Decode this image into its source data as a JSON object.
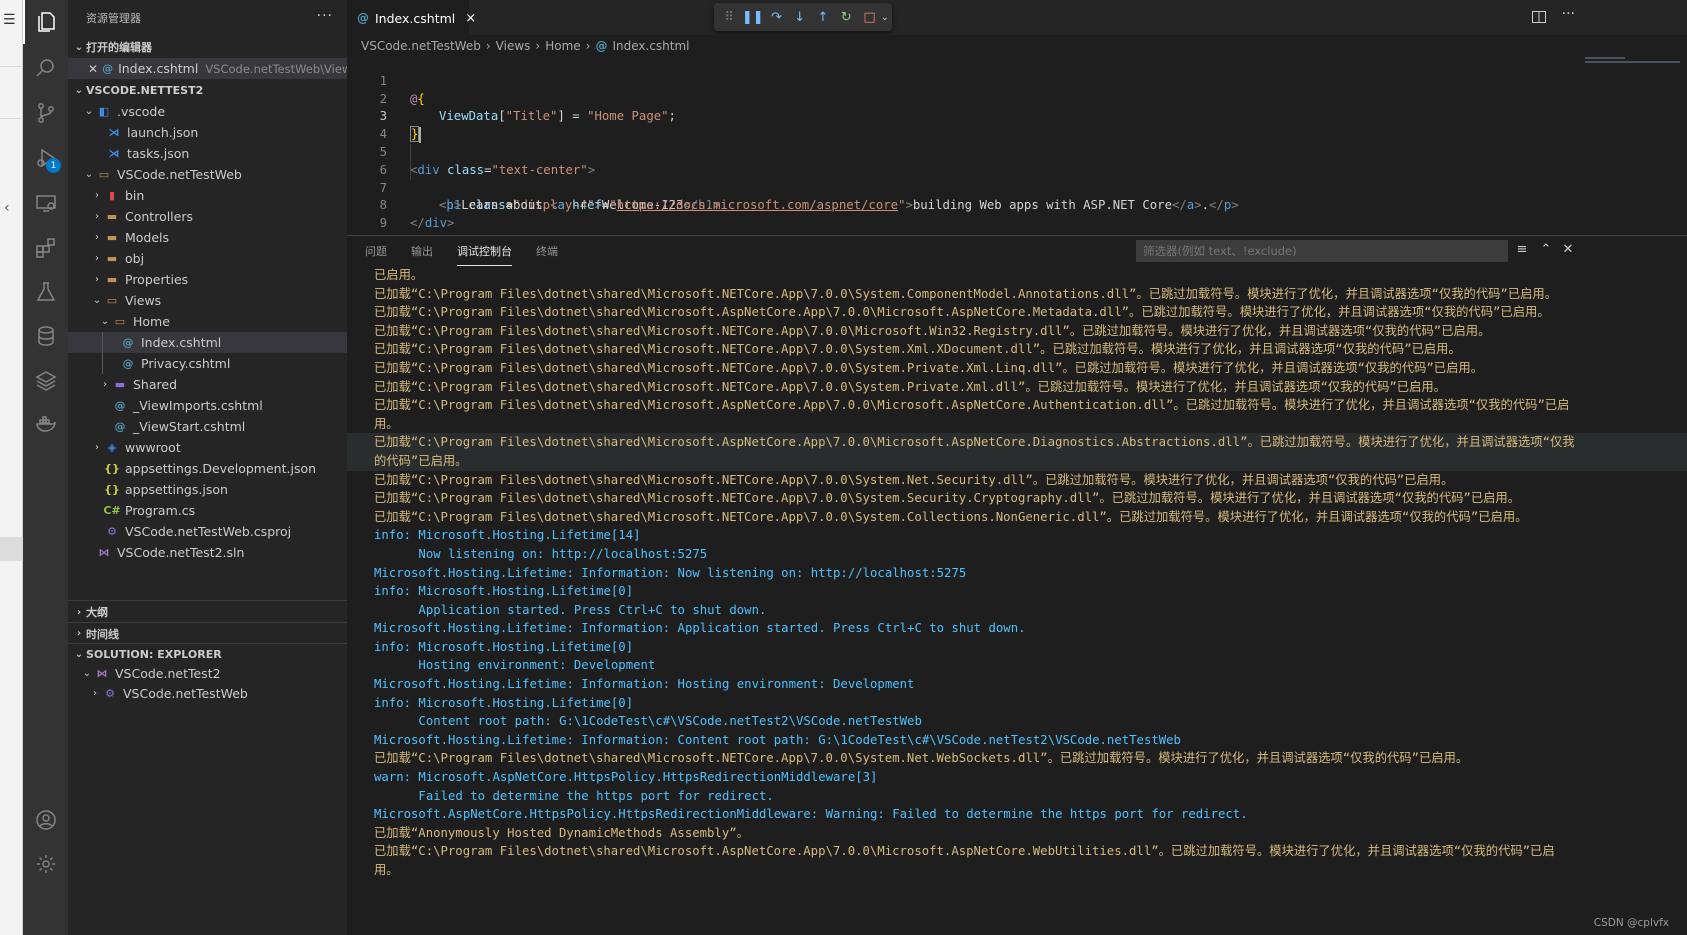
{
  "explorer": {
    "title": "资源管理器",
    "more": "···",
    "open_editors_label": "打开的编辑器",
    "open_editor": {
      "name": "Index.cshtml",
      "path": "VSCode.netTestWeb\\Views\\..."
    },
    "workspace_label": "VSCODE.NETTEST2",
    "tree": {
      "vscode_folder": ".vscode",
      "launch": "launch.json",
      "tasks": "tasks.json",
      "project": "VSCode.netTestWeb",
      "bin": "bin",
      "controllers": "Controllers",
      "models": "Models",
      "obj": "obj",
      "properties": "Properties",
      "views": "Views",
      "home": "Home",
      "index": "Index.cshtml",
      "privacy": "Privacy.cshtml",
      "shared": "Shared",
      "viewimports": "_ViewImports.cshtml",
      "viewstart": "_ViewStart.cshtml",
      "wwwroot": "wwwroot",
      "appsettings_dev": "appsettings.Development.json",
      "appsettings": "appsettings.json",
      "program": "Program.cs",
      "csproj": "VSCode.netTestWeb.csproj",
      "sln": "VSCode.netTest2.sln"
    },
    "outline_label": "大纲",
    "timeline_label": "时间线",
    "solution_label": "SOLUTION: EXPLORER",
    "solution_tree": {
      "solution": "VSCode.netTest2",
      "project": "VSCode.netTestWeb"
    }
  },
  "activity": {
    "debug_badge": "1"
  },
  "editor": {
    "tab_label": "Index.cshtml",
    "tab_close": "×",
    "breadcrumb": [
      "VSCode.netTestWeb",
      "Views",
      "Home",
      "Index.cshtml"
    ],
    "line_numbers": [
      "1",
      "2",
      "3",
      "4",
      "5",
      "6",
      "7",
      "8",
      "9"
    ],
    "code": {
      "l1_at": "@",
      "l1_brace": "{",
      "l2_viewdata": "ViewData",
      "l2_open": "[",
      "l2_key": "\"Title\"",
      "l2_close": "] = ",
      "l2_val": "\"Home Page\"",
      "l2_semi": ";",
      "l3_brace": "}",
      "l5_lt": "<",
      "l5_div": "div",
      "l5_class": "class",
      "l5_eq": "=",
      "l5_val": "\"text-center\"",
      "l5_gt": ">",
      "l6_lt": "<",
      "l6_h1": "h1",
      "l6_class": "class",
      "l6_eq": "=",
      "l6_val": "\"display-4\"",
      "l6_gt": ">",
      "l6_text": "Welcome-123",
      "l6_close": "</h1>",
      "l6_close_tag": "h1",
      "l7_lt": "<",
      "l7_p": "p",
      "l7_gt": ">",
      "l7_text1": "Learn about ",
      "l7_a_lt": "<",
      "l7_a": "a",
      "l7_href": "href",
      "l7_eq": "=",
      "l7_q1": "\"",
      "l7_url": "https://docs.microsoft.com/aspnet/core",
      "l7_q2": "\"",
      "l7_a_gt": ">",
      "l7_text2": "building Web apps with ASP.NET Core",
      "l7_a_close_lt": "</",
      "l7_a_close": "a",
      "l7_a_close_gt": ">",
      "l7_dot": ".",
      "l7_p_close_lt": "</",
      "l7_p_close": "p",
      "l7_p_close_gt": ">",
      "l8_lt": "</",
      "l8_div": "div",
      "l8_gt": ">"
    }
  },
  "panel": {
    "tabs": [
      "问题",
      "输出",
      "调试控制台",
      "终端"
    ],
    "filter_placeholder": "筛选器(例如 text、!exclude)",
    "console_lines": [
      {
        "t": "y",
        "text": "已启用。"
      },
      {
        "t": "y",
        "text": "已加载“C:\\Program Files\\dotnet\\shared\\Microsoft.NETCore.App\\7.0.0\\System.ComponentModel.Annotations.dll”。已跳过加载符号。模块进行了优化，并且调试器选项“仅我的代码”已启用。"
      },
      {
        "t": "y",
        "text": "已加载“C:\\Program Files\\dotnet\\shared\\Microsoft.AspNetCore.App\\7.0.0\\Microsoft.AspNetCore.Metadata.dll”。已跳过加载符号。模块进行了优化，并且调试器选项“仅我的代码”已启用。"
      },
      {
        "t": "y",
        "text": "已加载“C:\\Program Files\\dotnet\\shared\\Microsoft.NETCore.App\\7.0.0\\Microsoft.Win32.Registry.dll”。已跳过加载符号。模块进行了优化，并且调试器选项“仅我的代码”已启用。"
      },
      {
        "t": "y",
        "text": "已加载“C:\\Program Files\\dotnet\\shared\\Microsoft.NETCore.App\\7.0.0\\System.Xml.XDocument.dll”。已跳过加载符号。模块进行了优化，并且调试器选项“仅我的代码”已启用。"
      },
      {
        "t": "y",
        "text": "已加载“C:\\Program Files\\dotnet\\shared\\Microsoft.NETCore.App\\7.0.0\\System.Private.Xml.Linq.dll”。已跳过加载符号。模块进行了优化，并且调试器选项“仅我的代码”已启用。"
      },
      {
        "t": "y",
        "text": "已加载“C:\\Program Files\\dotnet\\shared\\Microsoft.NETCore.App\\7.0.0\\System.Private.Xml.dll”。已跳过加载符号。模块进行了优化，并且调试器选项“仅我的代码”已启用。"
      },
      {
        "t": "y",
        "text": "已加载“C:\\Program Files\\dotnet\\shared\\Microsoft.AspNetCore.App\\7.0.0\\Microsoft.AspNetCore.Authentication.dll”。已跳过加载符号。模块进行了优化，并且调试器选项“仅我的代码”已启"
      },
      {
        "t": "y",
        "text": "用。"
      },
      {
        "t": "y",
        "hl": true,
        "text": "已加载“C:\\Program Files\\dotnet\\shared\\Microsoft.AspNetCore.App\\7.0.0\\Microsoft.AspNetCore.Diagnostics.Abstractions.dll”。已跳过加载符号。模块进行了优化，并且调试器选项“仅我"
      },
      {
        "t": "y",
        "hl": true,
        "text": "的代码”已启用。"
      },
      {
        "t": "y",
        "text": "已加载“C:\\Program Files\\dotnet\\shared\\Microsoft.NETCore.App\\7.0.0\\System.Net.Security.dll”。已跳过加载符号。模块进行了优化，并且调试器选项“仅我的代码”已启用。"
      },
      {
        "t": "y",
        "text": "已加载“C:\\Program Files\\dotnet\\shared\\Microsoft.NETCore.App\\7.0.0\\System.Security.Cryptography.dll”。已跳过加载符号。模块进行了优化，并且调试器选项“仅我的代码”已启用。"
      },
      {
        "t": "y",
        "text": "已加载“C:\\Program Files\\dotnet\\shared\\Microsoft.NETCore.App\\7.0.0\\System.Collections.NonGeneric.dll”。已跳过加载符号。模块进行了优化，并且调试器选项“仅我的代码”已启用。"
      },
      {
        "t": "b",
        "text": "info: Microsoft.Hosting.Lifetime[14]"
      },
      {
        "t": "b",
        "text": "      Now listening on: http://localhost:5275"
      },
      {
        "t": "b",
        "text": "Microsoft.Hosting.Lifetime: Information: Now listening on: http://localhost:5275"
      },
      {
        "t": "b",
        "text": "info: Microsoft.Hosting.Lifetime[0]"
      },
      {
        "t": "b",
        "text": "      Application started. Press Ctrl+C to shut down."
      },
      {
        "t": "b",
        "text": "Microsoft.Hosting.Lifetime: Information: Application started. Press Ctrl+C to shut down."
      },
      {
        "t": "b",
        "text": "info: Microsoft.Hosting.Lifetime[0]"
      },
      {
        "t": "b",
        "text": "      Hosting environment: Development"
      },
      {
        "t": "b",
        "text": "Microsoft.Hosting.Lifetime: Information: Hosting environment: Development"
      },
      {
        "t": "b",
        "text": "info: Microsoft.Hosting.Lifetime[0]"
      },
      {
        "t": "b",
        "text": "      Content root path: G:\\1CodeTest\\c#\\VSCode.netTest2\\VSCode.netTestWeb"
      },
      {
        "t": "b",
        "text": "Microsoft.Hosting.Lifetime: Information: Content root path: G:\\1CodeTest\\c#\\VSCode.netTest2\\VSCode.netTestWeb"
      },
      {
        "t": "y",
        "text": "已加载“C:\\Program Files\\dotnet\\shared\\Microsoft.NETCore.App\\7.0.0\\System.Net.WebSockets.dll”。已跳过加载符号。模块进行了优化，并且调试器选项“仅我的代码”已启用。"
      },
      {
        "t": "b",
        "text": "warn: Microsoft.AspNetCore.HttpsPolicy.HttpsRedirectionMiddleware[3]"
      },
      {
        "t": "b",
        "text": "      Failed to determine the https port for redirect."
      },
      {
        "t": "b",
        "text": "Microsoft.AspNetCore.HttpsPolicy.HttpsRedirectionMiddleware: Warning: Failed to determine the https port for redirect."
      },
      {
        "t": "y",
        "text": "已加载“Anonymously Hosted DynamicMethods Assembly”。"
      },
      {
        "t": "y",
        "text": "已加载“C:\\Program Files\\dotnet\\shared\\Microsoft.AspNetCore.App\\7.0.0\\Microsoft.AspNetCore.WebUtilities.dll”。已跳过加载符号。模块进行了优化，并且调试器选项“仅我的代码”已启"
      },
      {
        "t": "y",
        "text": "用。"
      }
    ]
  },
  "watermark": "CSDN @cplvfx",
  "colors": {
    "accent": "#007acc",
    "console_yellow": "#d7ba7d",
    "console_blue": "#4fc1ff"
  }
}
